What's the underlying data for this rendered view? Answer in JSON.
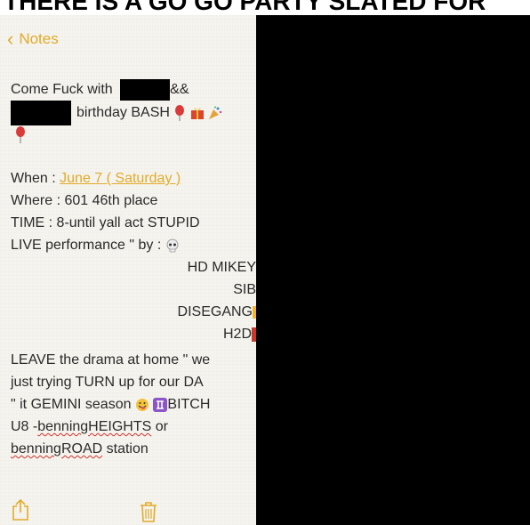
{
  "headline": "THERE IS A GO GO PARTY SLATED FOR",
  "nav": {
    "back_label": "Notes"
  },
  "note": {
    "line1": {
      "a": "Come Fuck with",
      "b": "&&"
    },
    "line2": {
      "a": "birthday BASH"
    },
    "when": {
      "label": "When : ",
      "value": "June 7 ( Saturday )"
    },
    "where": "Where : 601 46th place",
    "time": "TIME : 8-until yall act STUPID",
    "live": "LIVE performance \" by :",
    "acts": [
      "HD MIKEY",
      "SIB",
      "DISEGANG",
      "H2D"
    ],
    "leave": "LEAVE the drama at home \" we",
    "trying": "just trying TURN up for our DA",
    "gemini": {
      "a": "\" it GEMINI season",
      "b": "BITCH"
    },
    "u8": {
      "a": "U8 -",
      "b": "benningHEIGHTS",
      "c": " or"
    },
    "road": {
      "a": "benningROAD",
      "b": " station"
    }
  },
  "toolbar": {
    "share_icon": "share-icon",
    "trash_icon": "trash-icon"
  },
  "colors": {
    "accent": "#e0ab2a",
    "paper": "#f6f4ee",
    "redaction": "#000000"
  }
}
